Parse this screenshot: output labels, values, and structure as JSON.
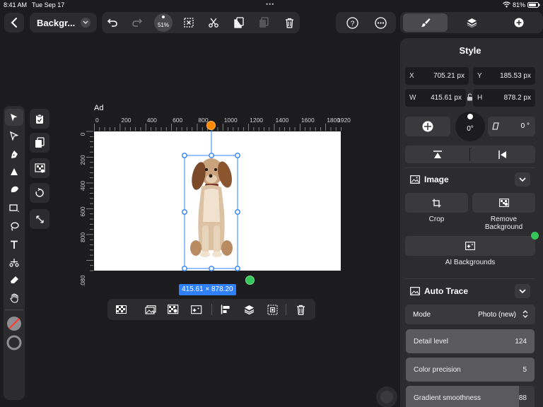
{
  "status_bar": {
    "time": "8:41 AM",
    "date": "Tue Sep 17",
    "battery": "81%"
  },
  "header": {
    "document_title": "Backgr...",
    "zoom_label": "51%"
  },
  "top_tabs": [
    "brush-tab",
    "layers-tab",
    "add-tab"
  ],
  "canvas": {
    "artboard_name": "Ad",
    "ruler_h_ticks": [
      "0",
      "200",
      "400",
      "600",
      "800",
      "1000",
      "1200",
      "1400",
      "1600",
      "1800",
      "1920"
    ],
    "ruler_v_ticks": [
      "0",
      "200",
      "400",
      "600",
      "800",
      "1080"
    ],
    "selection_dims": "415.61 × 878.20",
    "handle_colors": {
      "rotate": "#ff8a00",
      "green": "#34c759",
      "selection": "#2f80ff"
    }
  },
  "style_panel": {
    "title": "Style",
    "x_label": "X",
    "x_value": "705.21 px",
    "y_label": "Y",
    "y_value": "185.53 px",
    "w_label": "W",
    "w_value": "415.61 px",
    "h_label": "H",
    "h_value": "878.2 px",
    "rotation_value": "0°",
    "skew_value": "0 °"
  },
  "image_section": {
    "title": "Image",
    "crop_label": "Crop",
    "remove_bg_label_1": "Remove",
    "remove_bg_label_2": "Background",
    "ai_backgrounds_label": "AI Backgrounds"
  },
  "auto_trace": {
    "title": "Auto Trace",
    "mode_label": "Mode",
    "mode_value": "Photo (new)",
    "detail_label": "Detail level",
    "detail_value": "124",
    "detail_fraction": 1.0,
    "color_precision_label": "Color precision",
    "color_precision_value": "5",
    "color_precision_fraction": 1.0,
    "gradient_label": "Gradient smoothness",
    "gradient_value": "88",
    "gradient_fraction": 0.88
  }
}
